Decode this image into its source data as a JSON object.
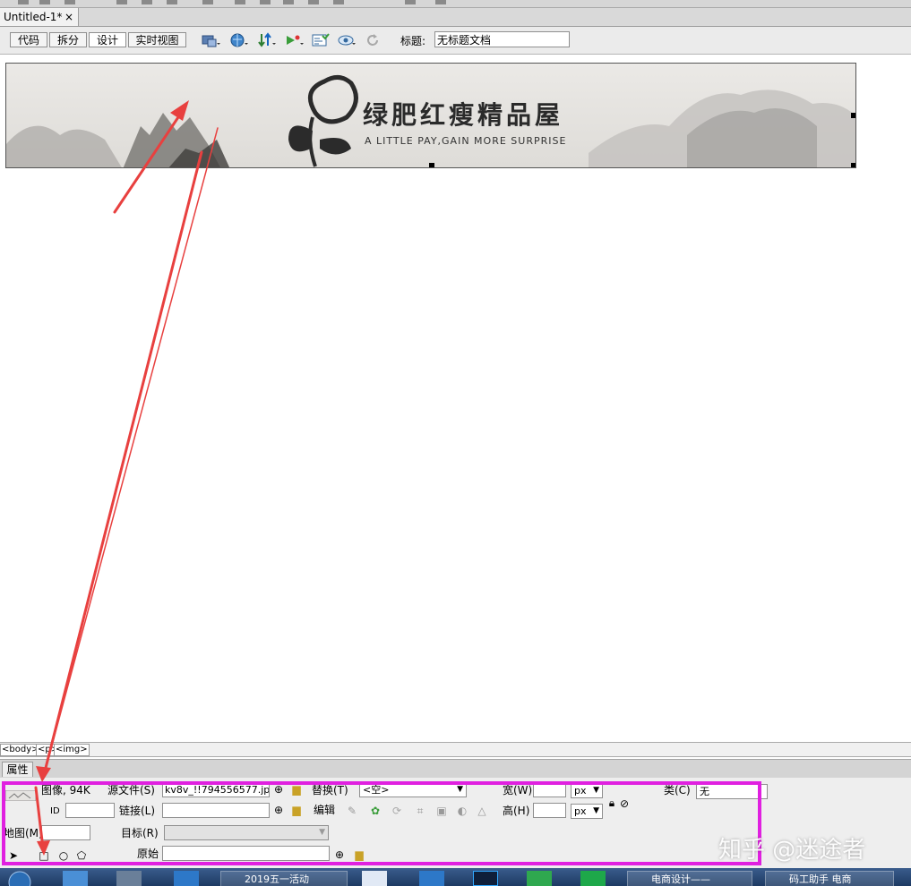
{
  "tab": {
    "title": "Untitled-1*",
    "close": "×"
  },
  "toolbar": {
    "views": [
      "代码",
      "拆分",
      "设计",
      "实时视图"
    ],
    "active_view": "设计",
    "title_label": "标题:",
    "title_value": "无标题文档"
  },
  "banner": {
    "title": "绿肥红瘦精品屋",
    "subtitle": "A LITTLE PAY,GAIN MORE SURPRISE"
  },
  "status": {
    "crumbs": [
      "<body>",
      "<p>",
      "<img>"
    ]
  },
  "properties": {
    "tab_label": "属性",
    "image_info": "图像, 94K",
    "src_label": "源文件(S)",
    "src_value": "kv8v_!!794556577.jpg",
    "alt_label": "替换(T)",
    "alt_value": "<空>",
    "width_label": "宽(W)",
    "height_label": "高(H)",
    "unit": "px",
    "class_label": "类(C)",
    "class_value": "无",
    "id_label": "ID",
    "link_label": "链接(L)",
    "edit_label": "编辑",
    "map_label": "地图(M)",
    "target_label": "目标(R)",
    "original_label": "原始"
  },
  "taskbar": {
    "items": [
      "2019五一活动",
      "电商设计——",
      "码工助手 电商"
    ]
  },
  "watermark": "知乎 @迷途者",
  "colors": {
    "highlight": "#e020e0",
    "arrow": "#e8403f"
  }
}
